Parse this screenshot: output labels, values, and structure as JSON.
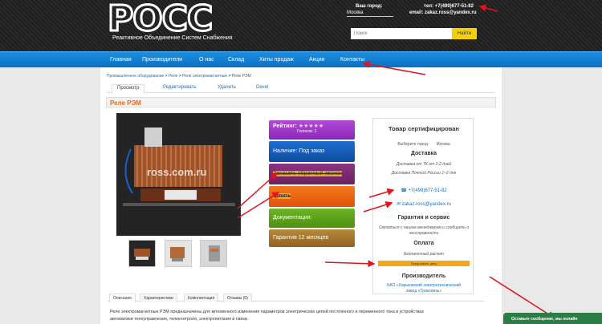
{
  "header": {
    "logo_text": "РОСС",
    "subtitle": "Реактивное Объединение Систем Снабжения",
    "city_label": "Ваш город:",
    "city_value": "Москва",
    "phone": "тел: +7(499)677-51-82",
    "email": "email: zakaz.ross@yandex.ru",
    "search_placeholder": "Поиск",
    "search_button": "Найти"
  },
  "nav": {
    "items": [
      "Главная",
      "Производители",
      "О нас",
      "Склад",
      "Хиты продаж",
      "Акции",
      "Контакты"
    ]
  },
  "breadcrumb": [
    "Промышленное оборудование",
    ">",
    "Реле",
    ">",
    "Реле электромагнитные",
    ">",
    "Реле РЭМ"
  ],
  "tabs": [
    "Просмотр",
    "Редактировать",
    "Удалить",
    "Devel"
  ],
  "product": {
    "title": "Реле РЭМ",
    "watermark": "ross.com.ru",
    "rating_label": "Рейтинг:",
    "stars": "★★★★★",
    "votes": "Голосов: 1",
    "availability": "Наличие: Под заказ",
    "callback": "Заказать обратный звонок",
    "buy": "Купить",
    "documentation": "Документация:",
    "warranty": "Гарантия 12 месяцев"
  },
  "info": {
    "certified": "Товар сертифицирован",
    "city_select_label": "Выберите город:",
    "city_select_value": "Москва",
    "delivery_title": "Доставка",
    "delivery_line1": "Доставка от ТК от 1-2 дней",
    "delivery_line2": "Доставка Почтой России 1–2 дня",
    "phone": "+7(499)677-51-82",
    "email": "zakaz.ross@yandex.ru",
    "warranty_title": "Гарантия и сервис",
    "warranty_text1": "Связаться с нашим менеджером и сообщить о",
    "warranty_text2": "неисправности",
    "payment_title": "Оплата",
    "payment_text": "Безналичный расчет",
    "payment_button": "Предложить цену",
    "manufacturer_title": "Производитель",
    "manufacturer_line1": "ЧАО «Харьковский электротехнический",
    "manufacturer_line2": "завод «Трансвязь»"
  },
  "bottom_tabs": [
    "Описание",
    "Характеристики",
    "Комплектация",
    "Отзывы (0)"
  ],
  "description_line1": "Реле электромагнитные РЭМ предназначены для мгновенного изменения параметров электрических цепей постоянного и переменного тока в устройствах",
  "description_line2": "автоматики телеуправления, телеконтроля, электропитания и связи.",
  "chat": "Оставьте сообщение, мы онлайн",
  "colors": {
    "nav_blue": "#0a6fc4",
    "title_orange": "#e86a1a",
    "rating_purple": "#9b2fbf",
    "availability_blue": "#1556b0",
    "callback_purple": "#7a2a6e",
    "buy_orange": "#e8640e",
    "doc_green": "#5fa317",
    "warranty_brown": "#a2772a",
    "search_yellow": "#f5d100",
    "chat_green": "#2b7d45",
    "annotation_red": "#e0141e"
  }
}
